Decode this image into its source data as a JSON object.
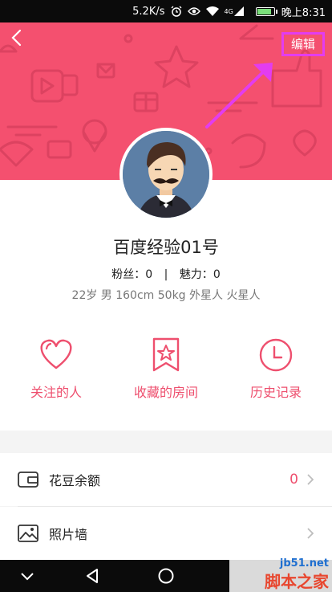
{
  "status_bar": {
    "network_speed": "5.2K/s",
    "network_type": "4G",
    "time": "晚上8:31",
    "icons": [
      "alarm-icon",
      "eye-icon",
      "wifi-icon",
      "signal-icon",
      "battery-icon"
    ]
  },
  "header": {
    "back_icon": "back-chevron-icon",
    "edit_label": "编辑",
    "highlight_color": "#e33cf0",
    "brand_color": "#f4506f"
  },
  "profile": {
    "username": "百度经验01号",
    "fans_label": "粉丝：",
    "fans_value": "0",
    "divider": "|",
    "charm_label": "魅力：",
    "charm_value": "0",
    "bio": "22岁 男 160cm 50kg 外星人 火星人",
    "avatar_icon": "avatar-man-mustache-icon"
  },
  "shortcuts": [
    {
      "label": "关注的人",
      "icon": "heart-icon"
    },
    {
      "label": "收藏的房间",
      "icon": "bookmark-star-icon"
    },
    {
      "label": "历史记录",
      "icon": "clock-icon"
    }
  ],
  "menu": [
    {
      "label": "花豆余额",
      "value": "0",
      "icon": "wallet-icon"
    },
    {
      "label": "照片墙",
      "value": "",
      "icon": "picture-icon"
    }
  ],
  "nav_bar": {
    "icons": [
      "nav-down-icon",
      "nav-back-icon",
      "nav-home-icon"
    ]
  },
  "watermark": {
    "url": "jb51.net",
    "text": "脚本之家"
  }
}
